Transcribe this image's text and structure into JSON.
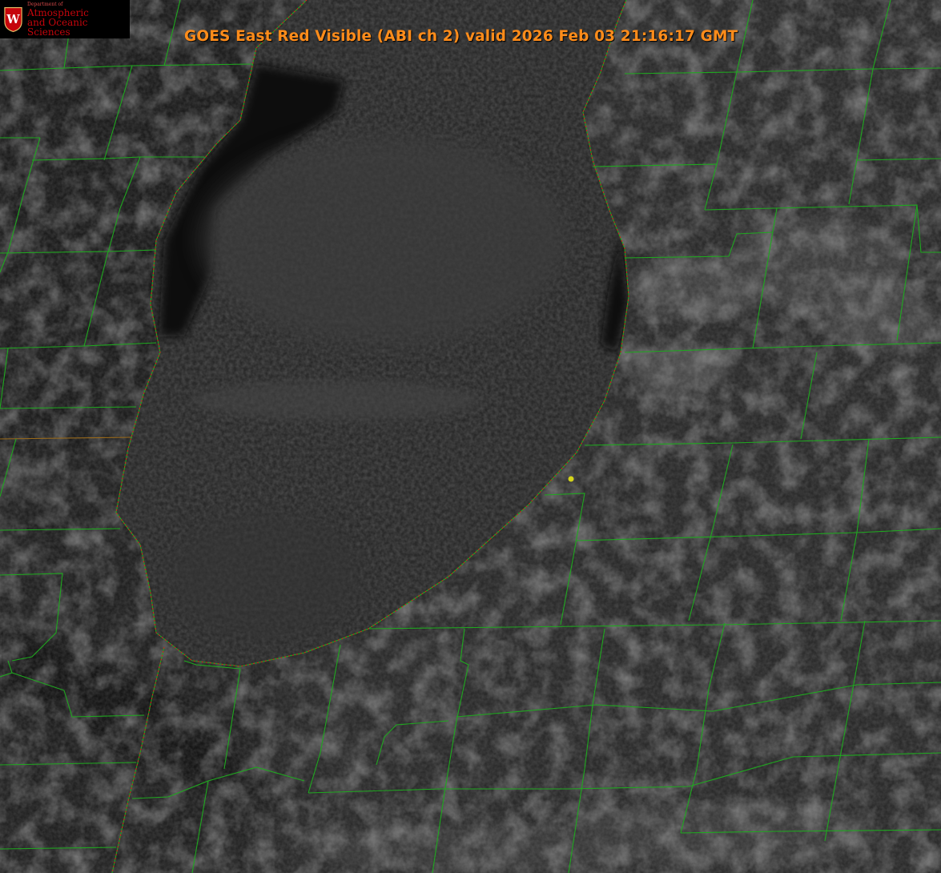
{
  "title": "GOES East Red Visible (ABI ch 2) valid 2026 Feb 03 21:16:17 GMT",
  "logo": {
    "letter": "W",
    "department": "Department of",
    "line1": "Atmospheric",
    "line2": "and Oceanic Sciences"
  },
  "colors": {
    "title": "#ff8c1a",
    "county_lines": "#1fa81f",
    "shoreline": "#e01818",
    "station_marker": "#d4d41a",
    "logo": "#c5050c"
  },
  "icons": {
    "crest": "uw-crest-icon",
    "marker": "station-dot-icon"
  }
}
